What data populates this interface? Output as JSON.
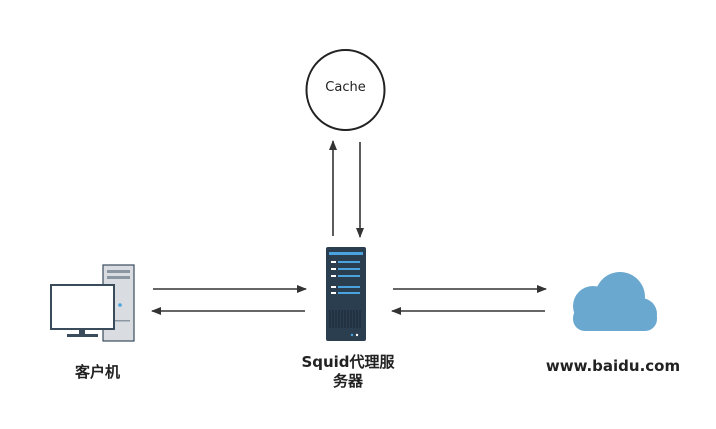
{
  "nodes": {
    "cache": {
      "label": "Cache"
    },
    "client": {
      "label": "客户机",
      "icon": "desktop-computer-icon"
    },
    "proxy": {
      "label_line1": "Squid代理服",
      "label_line2": "务器",
      "icon": "server-rack-icon"
    },
    "site": {
      "label": "www.baidu.com",
      "icon": "cloud-icon"
    }
  },
  "colors": {
    "arrow": "#333333",
    "server_body": "#2b3e50",
    "server_accent": "#4aa3df",
    "cloud": "#6aa8d0",
    "monitor_border": "#3a4b5c",
    "tower": "#d9dde2"
  }
}
